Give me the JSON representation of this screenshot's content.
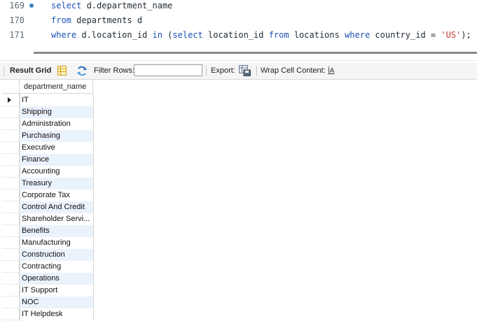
{
  "editor": {
    "lines": [
      {
        "num": "169",
        "text": "select d.department_name"
      },
      {
        "num": "170",
        "text": "from departments d"
      },
      {
        "num": "171",
        "text": "where d.location_id in (select location_id from locations where country_id = 'US');"
      }
    ]
  },
  "toolbar": {
    "result_grid_label": "Result Grid",
    "filter_rows_label": "Filter Rows:",
    "filter_value": "",
    "export_label": "Export:",
    "wrap_label": "Wrap Cell Content:",
    "wrap_icon_text": "ĪA"
  },
  "grid": {
    "column_header": "department_name",
    "rows": [
      "IT",
      "Shipping",
      "Administration",
      "Purchasing",
      "Executive",
      "Finance",
      "Accounting",
      "Treasury",
      "Corporate Tax",
      "Control And Credit",
      "Shareholder Servi...",
      "Benefits",
      "Manufacturing",
      "Construction",
      "Contracting",
      "Operations",
      "IT Support",
      "NOC",
      "IT Helpdesk"
    ]
  },
  "colors": {
    "keyword": "#1a4fb5",
    "string": "#c0392b",
    "alt_row": "#eaf2fb"
  }
}
